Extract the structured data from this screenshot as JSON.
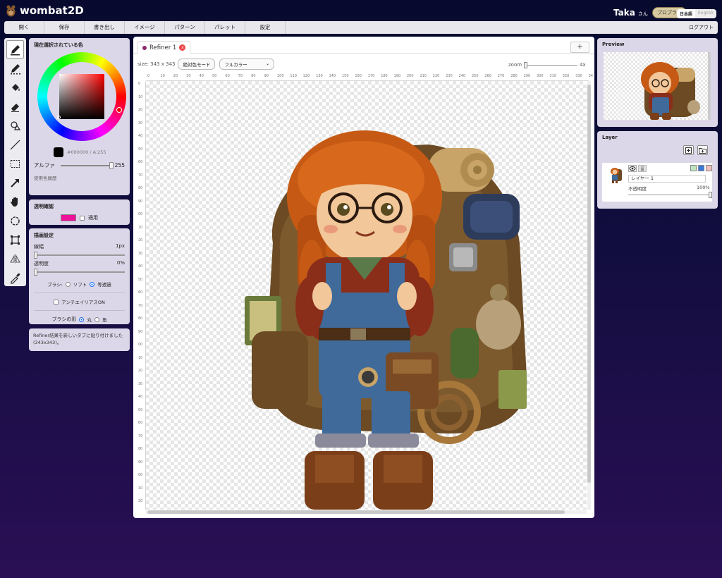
{
  "app": {
    "name": "wombat2D"
  },
  "user": {
    "name": "Taka",
    "suffix": "さん",
    "plan": "プロプラン"
  },
  "lang": {
    "ja": "日本語",
    "en": "English"
  },
  "menu": [
    "開く",
    "保存",
    "書き出し",
    "イメージ",
    "パターン",
    "パレット",
    "設定"
  ],
  "logout": "ログアウト",
  "tools": [
    "pencil",
    "dither-pen",
    "fill-bucket",
    "eraser",
    "shape",
    "line",
    "rect-select",
    "move-arrow",
    "hand",
    "lasso",
    "transform",
    "flip",
    "eyedropper"
  ],
  "color_panel": {
    "title": "現在選択されている色",
    "current_color": "#000000",
    "current_label": "#000000 / A:255",
    "alpha_label": "アルファ",
    "alpha_value": "255",
    "history_label": "使用色履歴"
  },
  "transparency_panel": {
    "title": "透明確認",
    "color": "#ee1199",
    "apply_label": "適用"
  },
  "draw_panel": {
    "title": "描画設定",
    "width_label": "線幅",
    "width_value": "1px",
    "opacity_label": "透明度",
    "opacity_value": "0%",
    "brush_label": "ブラシ:",
    "brush_soft": "ソフト",
    "brush_uniform": "等透過",
    "antialias_label": "アンチエイリアスON",
    "shape_label": "ブラシの形",
    "shape_round": "丸",
    "shape_square": "角"
  },
  "message": "Refiner結果を新しいタブに貼り付けました (343x343)。",
  "tab": {
    "label": "Refiner 1",
    "close": "x",
    "add": "+"
  },
  "canvas_toolbar": {
    "size_label": "size: 343 x 343",
    "absolute_mode": "絶対色モード",
    "color_mode": "フルカラー",
    "zoom_label": "zoom",
    "zoom_value": "4x"
  },
  "ruler": {
    "top": [
      "0",
      "10",
      "20",
      "30",
      "40",
      "50",
      "60",
      "70",
      "80",
      "90",
      "100",
      "110",
      "120",
      "130",
      "140",
      "150",
      "160",
      "170",
      "180",
      "190",
      "200",
      "210",
      "220",
      "230",
      "240",
      "250",
      "260",
      "270",
      "280",
      "290",
      "300",
      "310",
      "320",
      "330",
      "34"
    ],
    "left": [
      "0",
      "10",
      "20",
      "30",
      "40",
      "50",
      "60",
      "70",
      "80",
      "90",
      "00",
      "10",
      "20",
      "30",
      "40",
      "50",
      "60",
      "70",
      "80",
      "90",
      "00",
      "10",
      "20",
      "30",
      "40",
      "50",
      "60",
      "70",
      "80",
      "90",
      "00",
      "10",
      "20"
    ]
  },
  "preview": {
    "title": "Preview"
  },
  "layer": {
    "title": "Layer",
    "name": "レイヤー 1",
    "opacity_label": "不透明度",
    "opacity_value": "100%",
    "opacity_level": 1.0
  }
}
